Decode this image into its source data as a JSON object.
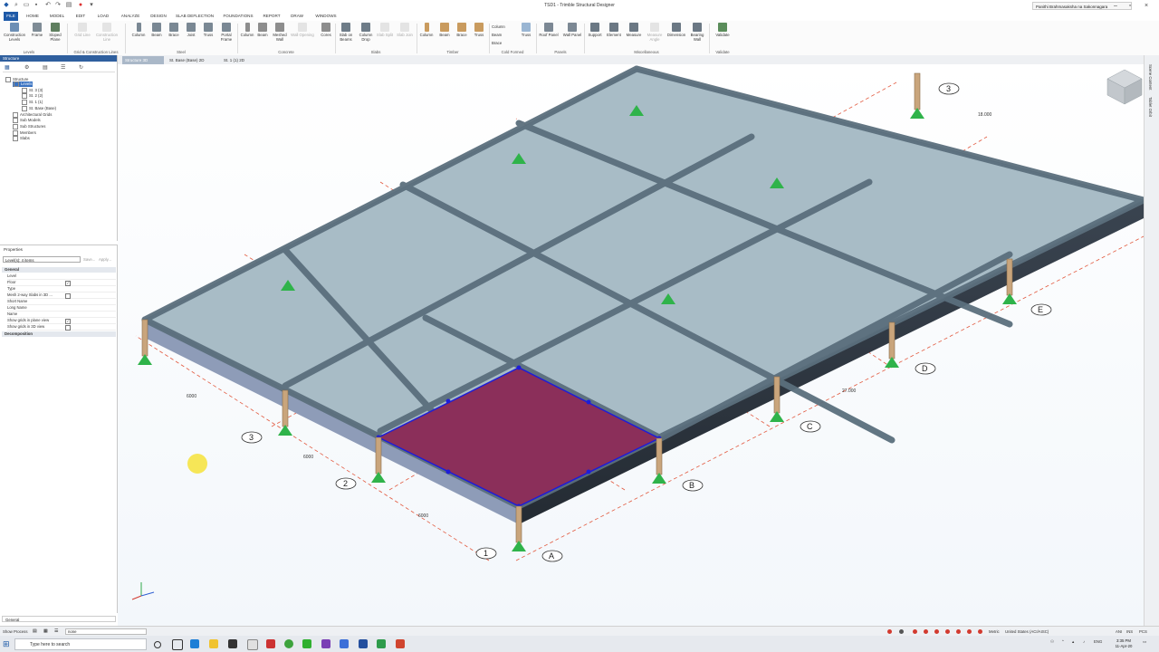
{
  "app": {
    "title": "TSD1 - Trimble Structural Designer",
    "user": "Panithi Brahmasaksha na Sakonnagara"
  },
  "menu": [
    "FILE",
    "HOME",
    "MODEL",
    "EDIT",
    "LOAD",
    "ANALYZE",
    "DESIGN",
    "SLAB DEFLECTION",
    "FOUNDATIONS",
    "REPORT",
    "DRAW",
    "WINDOWS"
  ],
  "ribbon": {
    "buttons": [
      "Construction Levels",
      "Frame",
      "Sloped Plane",
      "Grid Line",
      "Construction Line",
      "Column",
      "Beam",
      "Brace",
      "Joist",
      "Truss",
      "Portal Frame",
      "Column",
      "Beam",
      "Meshed Wall",
      "Wall Opening",
      "Cores",
      "Slab on Beams",
      "Column Drop",
      "Slab Split",
      "Slab Join",
      "Column",
      "Beam",
      "Brace",
      "Truss",
      "Roof Panel",
      "Wall Panel",
      "Support",
      "Element",
      "Measure",
      "Measure Angle",
      "Dimension",
      "Bearing Wall",
      "Validate"
    ],
    "cold_formed": [
      "Column",
      "Beam",
      "Brace"
    ],
    "groups": [
      "Levels",
      "Grid & Construction Lines",
      "Steel",
      "Concrete",
      "Slabs",
      "Timber",
      "Cold Formed",
      "Panels",
      "Miscellaneous",
      "Validate"
    ]
  },
  "doc_tabs": [
    "Structure 3D",
    "St. Base (Base) 2D",
    "St. 1 (1) 2D"
  ],
  "structure_panel": {
    "title": "Structure",
    "tree": [
      "Structure",
      "Levels",
      "St. 3 (3)",
      "St. 2 (2)",
      "St. 1 (1)",
      "St. Base (Base)",
      "Architectural Grids",
      "Sub Models",
      "Sub Structures",
      "Members",
      "Slabs"
    ]
  },
  "properties": {
    "title": "Properties",
    "selector": "Level(s): 4 items",
    "save_label": "Save...",
    "apply_label": "Apply...",
    "group_general": "General",
    "rows": [
      "Level",
      "Floor",
      "Type",
      "Mesh 2-way Slabs in 3D ...",
      "Short Name",
      "Long Name",
      "Name",
      "Show grids in plane view",
      "Show grids in 3D view"
    ],
    "group_decomp": "Decomposition",
    "footer": "General"
  },
  "viewport": {
    "grid_letters": [
      "A",
      "B",
      "C",
      "D",
      "E"
    ],
    "grid_numbers": [
      "1",
      "2",
      "3"
    ],
    "dims": [
      "6000",
      "6000",
      "6000",
      "27.000",
      "18.000"
    ],
    "view_cube": "View cube"
  },
  "right_tabs": [
    "Scene Content",
    "Tablet Orbit"
  ],
  "status": {
    "show_process": "Show Process",
    "field": "none",
    "units": "Metric",
    "code": "United States (ACI/AISC)",
    "zoom": "ANI",
    "extra": "INS",
    "pcs": "PCS"
  },
  "taskbar": {
    "search_placeholder": "Type here to search",
    "time": "3:35 PM",
    "date": "11-Apr-20"
  },
  "colors": {
    "ribbon_accent": "#1e5aa8",
    "selected_slab": "#8b2f5a",
    "slab": "#a8bcc6",
    "beam": "#5b6f7d",
    "column": "#c9a57c",
    "support": "#2fb34a"
  }
}
